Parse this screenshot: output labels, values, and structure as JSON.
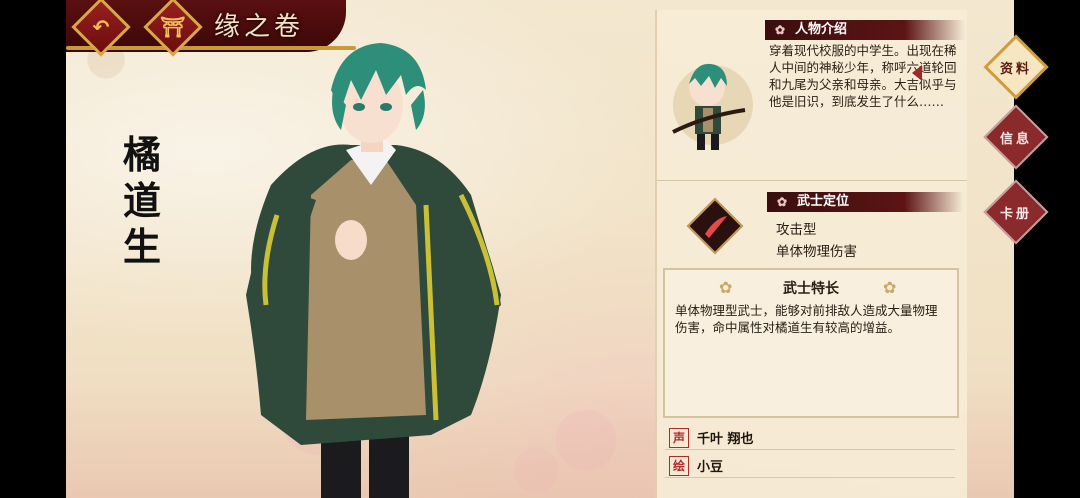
{
  "header": {
    "back_icon": "back-arrow-icon",
    "home_icon": "torii-home-icon",
    "title": "缘之卷"
  },
  "character": {
    "name": "橘道生",
    "name_chars": [
      "橘",
      "道",
      "生"
    ]
  },
  "profile": {
    "intro_heading": "人物介绍",
    "intro_text": "穿着现代校服的中学生。出现在稀人中间的神秘少年，称呼六道轮回和九尾为父亲和母亲。大吉似乎与他是旧识，到底发生了什么……",
    "role_heading": "武士定位",
    "role_icon": "sword-slash-icon",
    "role_type": "攻击型",
    "role_damage": "单体物理伤害",
    "specialty_heading": "武士特长",
    "specialty_text": "单体物理型武士，能够对前排敌人造成大量物理伤害，命中属性对橘道生有较高的增益。"
  },
  "credits": {
    "voice_label": "声",
    "voice_name": "千叶 翔也",
    "art_label": "绘",
    "art_name": "小豆"
  },
  "tabs": [
    {
      "label": "资料",
      "active": true
    },
    {
      "label": "信息",
      "active": false
    },
    {
      "label": "卡册",
      "active": false
    }
  ],
  "colors": {
    "accent_dark_red": "#5a0f10",
    "gold": "#c79b3a",
    "panel_bg": "#f6ecd6"
  }
}
